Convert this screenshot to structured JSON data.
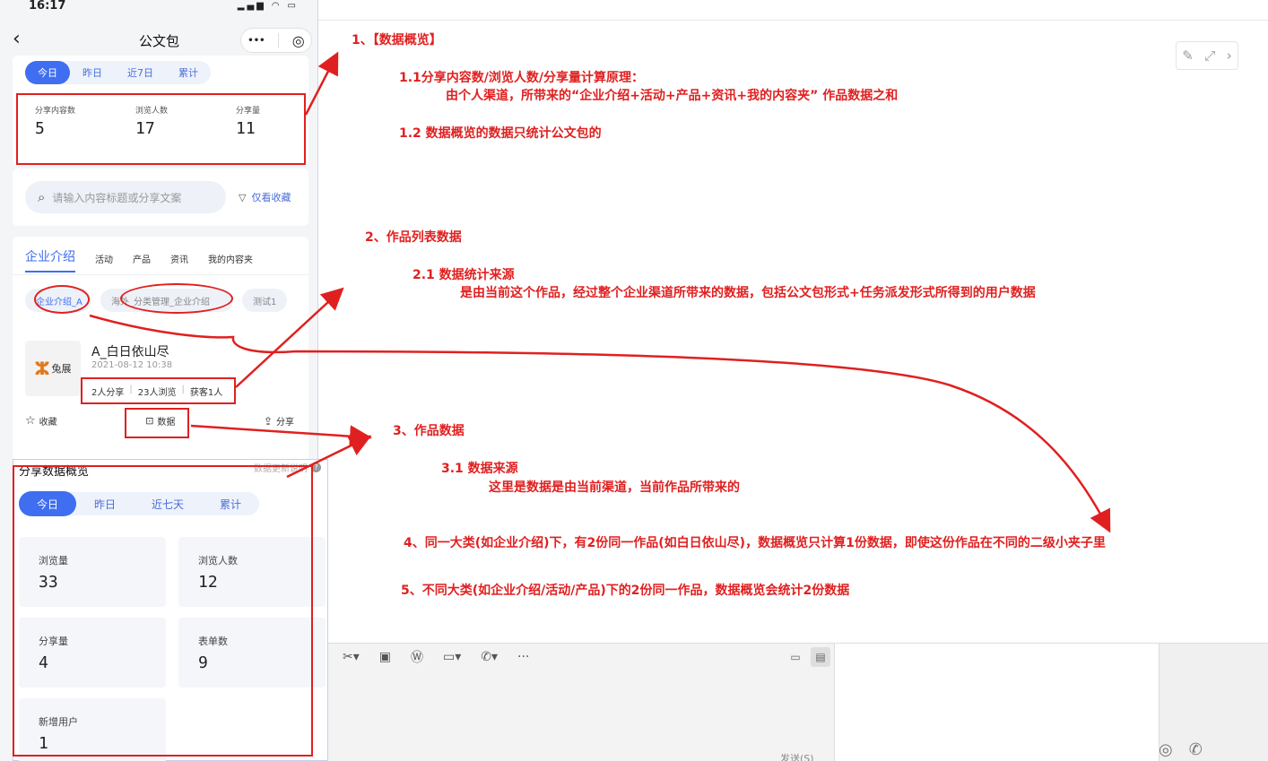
{
  "status": {
    "time": "16:17",
    "signal": "▂▄▆",
    "wifi": "◠",
    "battery": "▭"
  },
  "nav": {
    "title": "公文包",
    "back": "‹",
    "more": "•••",
    "target": "◎"
  },
  "overview": {
    "chips": [
      "今日",
      "昨日",
      "近7日",
      "累计"
    ],
    "stats": [
      {
        "label": "分享内容数",
        "value": "5"
      },
      {
        "label": "浏览人数",
        "value": "17"
      },
      {
        "label": "分享量",
        "value": "11"
      }
    ]
  },
  "search": {
    "placeholder": "请输入内容标题或分享文案",
    "filter": "仅看收藏"
  },
  "tabs": [
    "企业介绍",
    "活动",
    "产品",
    "资讯",
    "我的内容夹"
  ],
  "subchips": [
    "企业介绍_A",
    "海外_分类管理_企业介绍",
    "测试1"
  ],
  "item": {
    "thumb_text": "兔展",
    "title": "A_白日依山尽",
    "date": "2021-08-12 10:38",
    "stats": [
      "2人分享",
      "23人浏览",
      "获客1人"
    ],
    "actions": {
      "fav": "收藏",
      "data": "数据",
      "share": "分享"
    }
  },
  "share_panel": {
    "title": "分享数据概览",
    "note": "数据更新说明",
    "chips": [
      "今日",
      "昨日",
      "近七天",
      "累计"
    ],
    "metrics": [
      {
        "label": "浏览量",
        "value": "33"
      },
      {
        "label": "浏览人数",
        "value": "12"
      },
      {
        "label": "分享量",
        "value": "4"
      },
      {
        "label": "表单数",
        "value": "9"
      },
      {
        "label": "新增用户",
        "value": "1"
      }
    ]
  },
  "annotations": {
    "a1": "1、【数据概览】",
    "a1_1": "1.1分享内容数/浏览人数/分享量计算原理：",
    "a1_1b": "由个人渠道，所带来的“企业介绍+活动+产品+资讯+我的内容夹” 作品数据之和",
    "a1_2": "1.2 数据概览的数据只统计公文包的",
    "a2": "2、作品列表数据",
    "a2_1": "2.1 数据统计来源",
    "a2_1b": "是由当前这个作品，经过整个企业渠道所带来的数据，包括公文包形式+任务派发形式所得到的用户数据",
    "a3": "3、作品数据",
    "a3_1": "3.1 数据来源",
    "a3_1b": "这里是数据是由当前渠道，当前作品所带来的",
    "a4": "4、同一大类(如企业介绍)下，有2份同一作品(如白日依山尽)，数据概览只计算1份数据，即使这份作品在不同的二级小夹子里",
    "a5": "5、不同大类(如企业介绍/活动/产品)下的2份同一作品，数据概览会统计2份数据"
  },
  "desktop": {
    "send": "发送(S)"
  },
  "colors": {
    "accent": "#3f6ef0",
    "annotation": "#e02020"
  }
}
